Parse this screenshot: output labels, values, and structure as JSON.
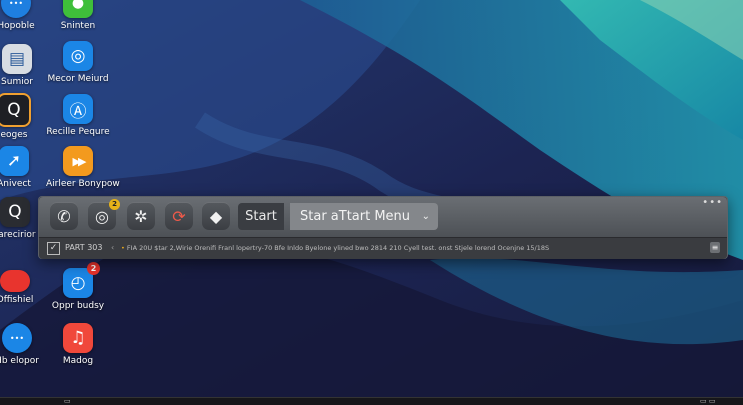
{
  "desktop_icons": [
    {
      "label": "Hopoble",
      "icon": "dots-icon",
      "glyph": "•••",
      "color": "#1e7fe0"
    },
    {
      "label": "Sninten",
      "icon": "chat-bubble-icon",
      "glyph": "●",
      "color": "#3fbf3a"
    },
    {
      "label": "Sumior",
      "icon": "window-icon",
      "glyph": "▤",
      "color": "#d8dde3"
    },
    {
      "label": "Mecor Meiurd",
      "icon": "target-icon",
      "glyph": "◎",
      "color": "#1b86e6"
    },
    {
      "label": "eoges",
      "icon": "search-icon",
      "glyph": "Q",
      "color": "#1e1f24"
    },
    {
      "label": "Recille Pequre",
      "icon": "app-store-icon",
      "glyph": "Ⓐ",
      "color": "#1b86e6"
    },
    {
      "label": "Anivect",
      "icon": "arrow-icon",
      "glyph": "➚",
      "color": "#1b86e6"
    },
    {
      "label": "Airleer Bonypow",
      "icon": "play-icon",
      "glyph": "▶▶",
      "color": "#f39a1e"
    },
    {
      "label": "rarecirior",
      "icon": "search-icon",
      "glyph": "Q",
      "color": "#2a2c31"
    },
    {
      "label": "Offishiel",
      "icon": "pill-icon",
      "glyph": "",
      "color": "#e8342e"
    },
    {
      "label": "Oppr budsy",
      "icon": "compass-icon",
      "glyph": "◴",
      "color": "#1b86e6",
      "badge": "2"
    },
    {
      "label": "Hb elopor",
      "icon": "ellipsis-icon",
      "glyph": "•••",
      "color": "#1b86e6"
    },
    {
      "label": "Madog",
      "icon": "music-note-icon",
      "glyph": "♫",
      "color": "#f0483b"
    }
  ],
  "dock": {
    "apps": [
      {
        "name": "phone-icon",
        "glyph": "✆"
      },
      {
        "name": "camera-target-icon",
        "glyph": "◎",
        "badge": "2"
      },
      {
        "name": "aperture-icon",
        "glyph": "✲"
      },
      {
        "name": "refresh-icon",
        "glyph": "⟳"
      },
      {
        "name": "shield-icon",
        "glyph": "◆"
      }
    ],
    "start_label": "Start",
    "menu_select_value": "Star aTtart Menu",
    "more_glyph": "•••",
    "status": {
      "label": "PART 303",
      "separator": "‹",
      "text": "FIA 20U $tar 2,Wirie Orenifi Franl lopertry-70 Bfe Inldo Byelone ylined bwo 2814 210 Cyell test. onst Stjele lorend Ocenjne 15/18S",
      "end_glyph": "≡"
    }
  },
  "colors": {
    "wallpaper_deep": "#1b1e45",
    "wallpaper_teal": "#1f8fa8",
    "dock_bg": "#4d5156",
    "accent_badge": "#e6b219"
  }
}
